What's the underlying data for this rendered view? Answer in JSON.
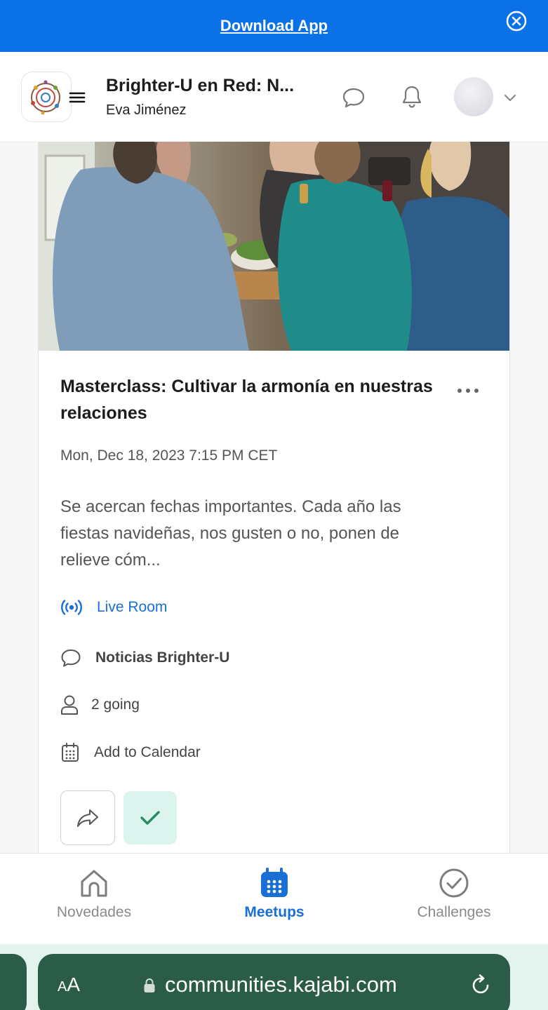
{
  "banner": {
    "download_label": "Download App"
  },
  "header": {
    "community_title": "Brighter-U en Red: N...",
    "author": "Eva Jiménez"
  },
  "event": {
    "title": "Masterclass: Cultivar la armonía en nuestras relaciones",
    "datetime": "Mon, Dec 18, 2023 7:15 PM CET",
    "description": "Se acercan fechas importantes. Cada año las fiestas navideñas, nos gusten o no, ponen de relieve cóm...",
    "live_room_label": "Live Room",
    "category": "Noticias Brighter-U",
    "going": "2 going",
    "add_to_calendar": "Add to Calendar"
  },
  "tabs": [
    {
      "label": "Novedades",
      "icon": "home-icon"
    },
    {
      "label": "Meetups",
      "icon": "calendar-icon"
    },
    {
      "label": "Challenges",
      "icon": "check-circle-icon"
    }
  ],
  "browser": {
    "text_size_label_small": "A",
    "text_size_label_large": "A",
    "url": "communities.kajabi.com"
  },
  "colors": {
    "banner_blue": "#0a72e6",
    "link_blue": "#1a6fd6",
    "attending_green": "#dcf4ee",
    "browser_green": "#2a5c47"
  }
}
